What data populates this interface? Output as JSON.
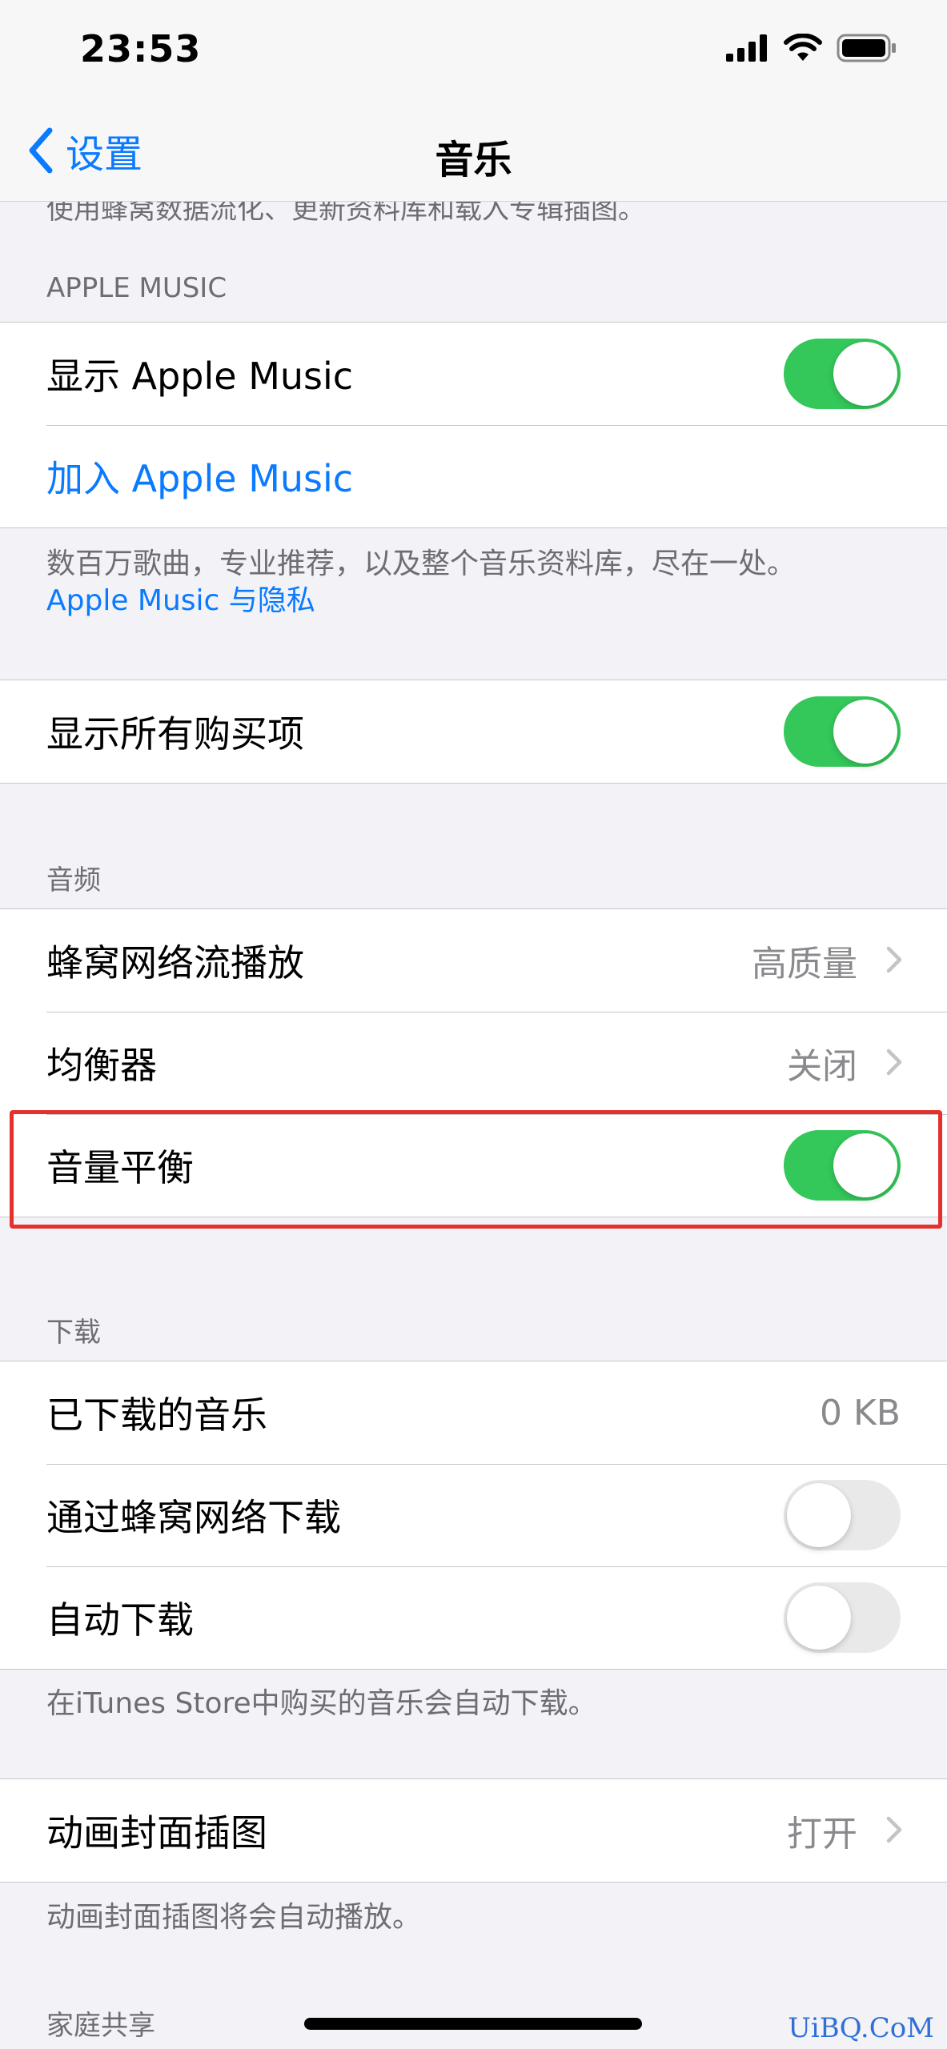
{
  "status_bar": {
    "time": "23:53"
  },
  "nav": {
    "back_label": "设置",
    "title": "音乐"
  },
  "top_clipped_footer": "使用蜂窝数据流化、更新资料库和载入专辑插图。",
  "apple_music": {
    "header": "APPLE MUSIC",
    "show_label": "显示 Apple Music",
    "show_toggle": true,
    "join_label": "加入 Apple Music",
    "footer_text": "数百万歌曲，专业推荐，以及整个音乐资料库，尽在一处。",
    "footer_link": "Apple Music 与隐私"
  },
  "purchases": {
    "show_all_label": "显示所有购买项",
    "show_all_toggle": true
  },
  "audio": {
    "header": "音频",
    "cellular_streaming_label": "蜂窝网络流播放",
    "cellular_streaming_value": "高质量",
    "eq_label": "均衡器",
    "eq_value": "关闭",
    "sound_check_label": "音量平衡",
    "sound_check_toggle": true
  },
  "downloads": {
    "header": "下载",
    "downloaded_label": "已下载的音乐",
    "downloaded_value": "0 KB",
    "cellular_download_label": "通过蜂窝网络下载",
    "cellular_download_toggle": false,
    "auto_download_label": "自动下载",
    "auto_download_toggle": false,
    "footer": "在iTunes Store中购买的音乐会自动下载。"
  },
  "animated_art": {
    "label": "动画封面插图",
    "value": "打开",
    "footer": "动画封面插图将会自动播放。"
  },
  "family_sharing": {
    "header": "家庭共享"
  },
  "watermark": "UiBQ.CoM",
  "colors": {
    "accent": "#0a7aff",
    "toggle_on": "#34c759",
    "highlight": "#e5302d"
  },
  "icons": [
    "signal-icon",
    "wifi-icon",
    "battery-icon",
    "back-chevron-icon",
    "row-chevron-icon"
  ]
}
